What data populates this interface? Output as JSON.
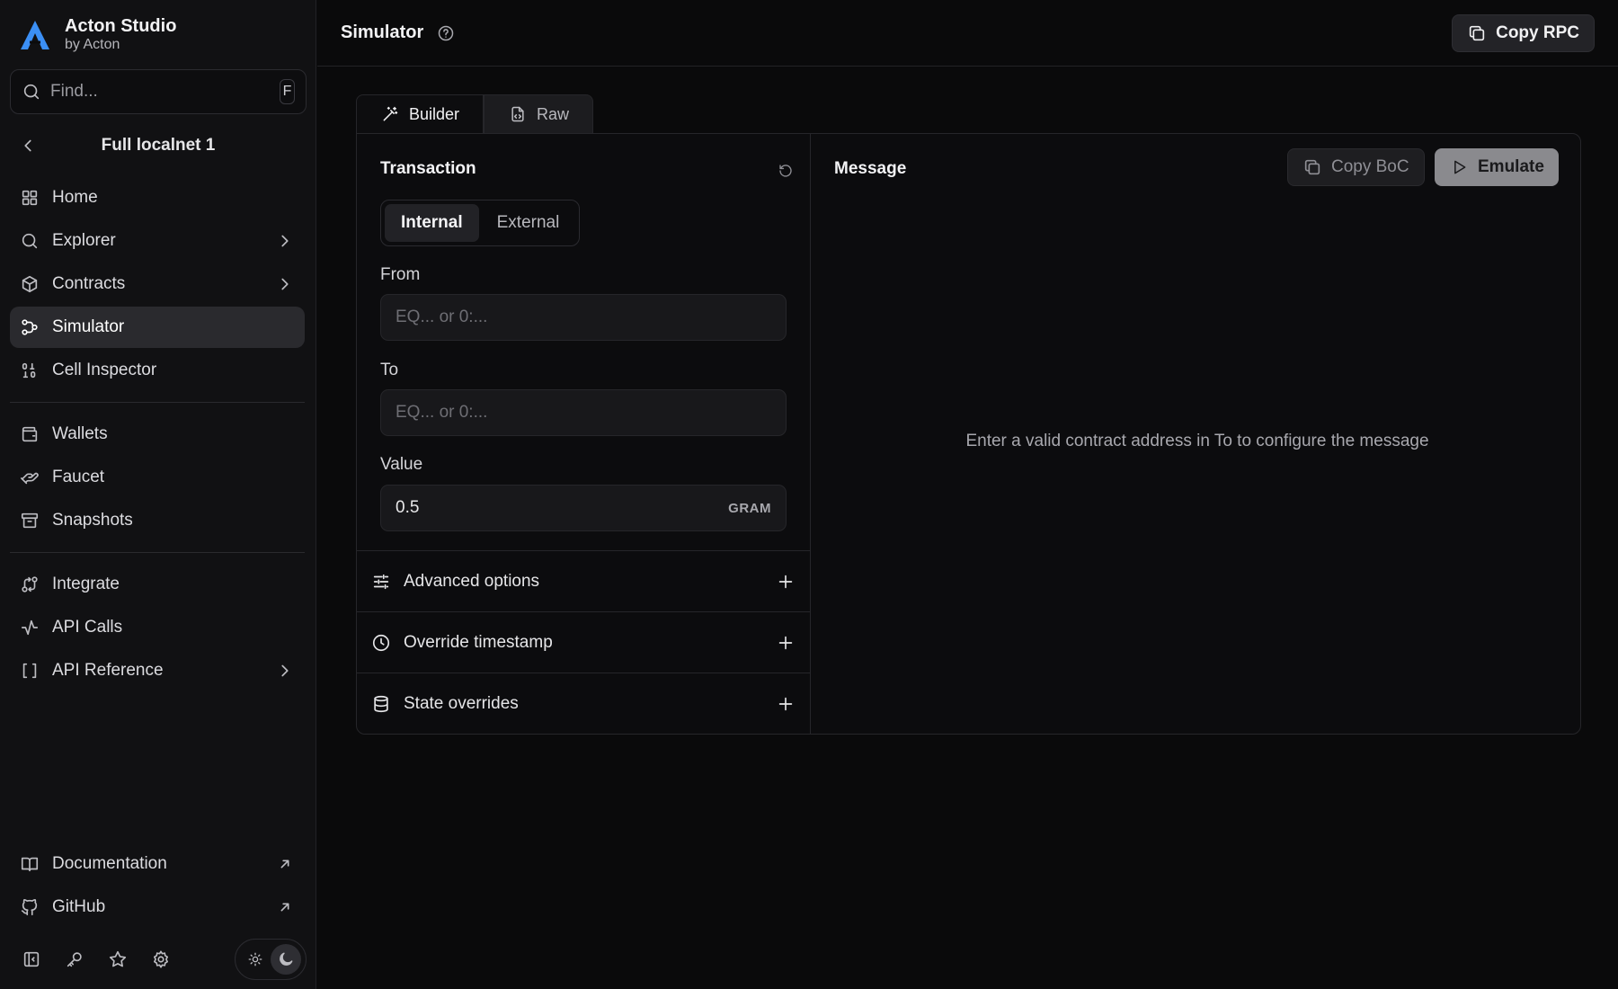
{
  "brand": {
    "title": "Acton Studio",
    "subtitle": "by Acton",
    "accent": "#3b8ff5"
  },
  "search": {
    "placeholder": "Find...",
    "shortcut": "F"
  },
  "network": {
    "title": "Full localnet 1"
  },
  "nav": {
    "primary": [
      {
        "label": "Home",
        "icon": "grid-icon"
      },
      {
        "label": "Explorer",
        "icon": "search-icon",
        "has_children": true
      },
      {
        "label": "Contracts",
        "icon": "box-icon",
        "has_children": true
      },
      {
        "label": "Simulator",
        "icon": "workflow-icon",
        "active": true
      },
      {
        "label": "Cell Inspector",
        "icon": "binary-icon"
      }
    ],
    "secondary": [
      {
        "label": "Wallets",
        "icon": "wallet-icon"
      },
      {
        "label": "Faucet",
        "icon": "faucet-icon"
      },
      {
        "label": "Snapshots",
        "icon": "archive-icon"
      }
    ],
    "tertiary": [
      {
        "label": "Integrate",
        "icon": "integrate-icon"
      },
      {
        "label": "API Calls",
        "icon": "activity-icon"
      },
      {
        "label": "API Reference",
        "icon": "brackets-icon",
        "has_children": true
      }
    ],
    "footer": [
      {
        "label": "Documentation",
        "icon": "book-icon",
        "external": true
      },
      {
        "label": "GitHub",
        "icon": "github-icon",
        "external": true
      }
    ]
  },
  "header": {
    "title": "Simulator",
    "copy_rpc": "Copy RPC"
  },
  "tabs": [
    {
      "label": "Builder",
      "icon": "wand-icon"
    },
    {
      "label": "Raw",
      "icon": "file-code-icon"
    }
  ],
  "transaction": {
    "title": "Transaction",
    "modes": [
      "Internal",
      "External"
    ],
    "selected_mode": "Internal",
    "from": {
      "label": "From",
      "placeholder": "EQ... or 0:...",
      "value": ""
    },
    "to": {
      "label": "To",
      "placeholder": "EQ... or 0:...",
      "value": ""
    },
    "value": {
      "label": "Value",
      "value": "0.5",
      "unit": "GRAM"
    },
    "sections": [
      {
        "label": "Advanced options",
        "icon": "sliders-icon"
      },
      {
        "label": "Override timestamp",
        "icon": "clock-icon"
      },
      {
        "label": "State overrides",
        "icon": "database-icon"
      }
    ]
  },
  "message": {
    "title": "Message",
    "copy_boc": "Copy BoC",
    "emulate": "Emulate",
    "empty_text": "Enter a valid contract address in To to configure the message"
  }
}
